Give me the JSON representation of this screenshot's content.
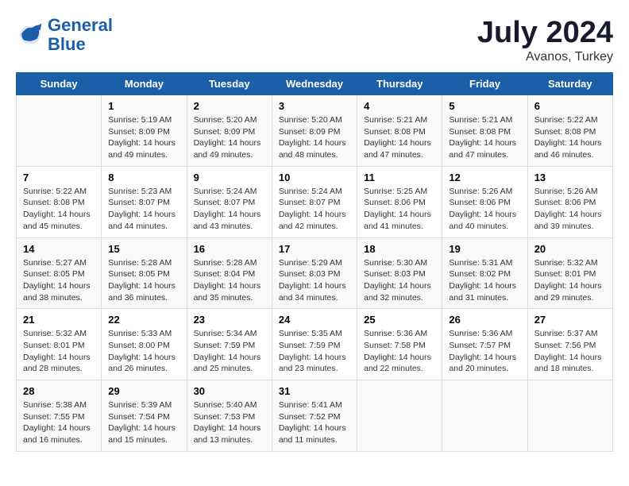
{
  "header": {
    "logo_line1": "General",
    "logo_line2": "Blue",
    "main_title": "July 2024",
    "subtitle": "Avanos, Turkey"
  },
  "columns": [
    "Sunday",
    "Monday",
    "Tuesday",
    "Wednesday",
    "Thursday",
    "Friday",
    "Saturday"
  ],
  "weeks": [
    [
      {
        "day": "",
        "content": ""
      },
      {
        "day": "1",
        "content": "Sunrise: 5:19 AM\nSunset: 8:09 PM\nDaylight: 14 hours\nand 49 minutes."
      },
      {
        "day": "2",
        "content": "Sunrise: 5:20 AM\nSunset: 8:09 PM\nDaylight: 14 hours\nand 49 minutes."
      },
      {
        "day": "3",
        "content": "Sunrise: 5:20 AM\nSunset: 8:09 PM\nDaylight: 14 hours\nand 48 minutes."
      },
      {
        "day": "4",
        "content": "Sunrise: 5:21 AM\nSunset: 8:08 PM\nDaylight: 14 hours\nand 47 minutes."
      },
      {
        "day": "5",
        "content": "Sunrise: 5:21 AM\nSunset: 8:08 PM\nDaylight: 14 hours\nand 47 minutes."
      },
      {
        "day": "6",
        "content": "Sunrise: 5:22 AM\nSunset: 8:08 PM\nDaylight: 14 hours\nand 46 minutes."
      }
    ],
    [
      {
        "day": "7",
        "content": "Sunrise: 5:22 AM\nSunset: 8:08 PM\nDaylight: 14 hours\nand 45 minutes."
      },
      {
        "day": "8",
        "content": "Sunrise: 5:23 AM\nSunset: 8:07 PM\nDaylight: 14 hours\nand 44 minutes."
      },
      {
        "day": "9",
        "content": "Sunrise: 5:24 AM\nSunset: 8:07 PM\nDaylight: 14 hours\nand 43 minutes."
      },
      {
        "day": "10",
        "content": "Sunrise: 5:24 AM\nSunset: 8:07 PM\nDaylight: 14 hours\nand 42 minutes."
      },
      {
        "day": "11",
        "content": "Sunrise: 5:25 AM\nSunset: 8:06 PM\nDaylight: 14 hours\nand 41 minutes."
      },
      {
        "day": "12",
        "content": "Sunrise: 5:26 AM\nSunset: 8:06 PM\nDaylight: 14 hours\nand 40 minutes."
      },
      {
        "day": "13",
        "content": "Sunrise: 5:26 AM\nSunset: 8:06 PM\nDaylight: 14 hours\nand 39 minutes."
      }
    ],
    [
      {
        "day": "14",
        "content": "Sunrise: 5:27 AM\nSunset: 8:05 PM\nDaylight: 14 hours\nand 38 minutes."
      },
      {
        "day": "15",
        "content": "Sunrise: 5:28 AM\nSunset: 8:05 PM\nDaylight: 14 hours\nand 36 minutes."
      },
      {
        "day": "16",
        "content": "Sunrise: 5:28 AM\nSunset: 8:04 PM\nDaylight: 14 hours\nand 35 minutes."
      },
      {
        "day": "17",
        "content": "Sunrise: 5:29 AM\nSunset: 8:03 PM\nDaylight: 14 hours\nand 34 minutes."
      },
      {
        "day": "18",
        "content": "Sunrise: 5:30 AM\nSunset: 8:03 PM\nDaylight: 14 hours\nand 32 minutes."
      },
      {
        "day": "19",
        "content": "Sunrise: 5:31 AM\nSunset: 8:02 PM\nDaylight: 14 hours\nand 31 minutes."
      },
      {
        "day": "20",
        "content": "Sunrise: 5:32 AM\nSunset: 8:01 PM\nDaylight: 14 hours\nand 29 minutes."
      }
    ],
    [
      {
        "day": "21",
        "content": "Sunrise: 5:32 AM\nSunset: 8:01 PM\nDaylight: 14 hours\nand 28 minutes."
      },
      {
        "day": "22",
        "content": "Sunrise: 5:33 AM\nSunset: 8:00 PM\nDaylight: 14 hours\nand 26 minutes."
      },
      {
        "day": "23",
        "content": "Sunrise: 5:34 AM\nSunset: 7:59 PM\nDaylight: 14 hours\nand 25 minutes."
      },
      {
        "day": "24",
        "content": "Sunrise: 5:35 AM\nSunset: 7:59 PM\nDaylight: 14 hours\nand 23 minutes."
      },
      {
        "day": "25",
        "content": "Sunrise: 5:36 AM\nSunset: 7:58 PM\nDaylight: 14 hours\nand 22 minutes."
      },
      {
        "day": "26",
        "content": "Sunrise: 5:36 AM\nSunset: 7:57 PM\nDaylight: 14 hours\nand 20 minutes."
      },
      {
        "day": "27",
        "content": "Sunrise: 5:37 AM\nSunset: 7:56 PM\nDaylight: 14 hours\nand 18 minutes."
      }
    ],
    [
      {
        "day": "28",
        "content": "Sunrise: 5:38 AM\nSunset: 7:55 PM\nDaylight: 14 hours\nand 16 minutes."
      },
      {
        "day": "29",
        "content": "Sunrise: 5:39 AM\nSunset: 7:54 PM\nDaylight: 14 hours\nand 15 minutes."
      },
      {
        "day": "30",
        "content": "Sunrise: 5:40 AM\nSunset: 7:53 PM\nDaylight: 14 hours\nand 13 minutes."
      },
      {
        "day": "31",
        "content": "Sunrise: 5:41 AM\nSunset: 7:52 PM\nDaylight: 14 hours\nand 11 minutes."
      },
      {
        "day": "",
        "content": ""
      },
      {
        "day": "",
        "content": ""
      },
      {
        "day": "",
        "content": ""
      }
    ]
  ]
}
